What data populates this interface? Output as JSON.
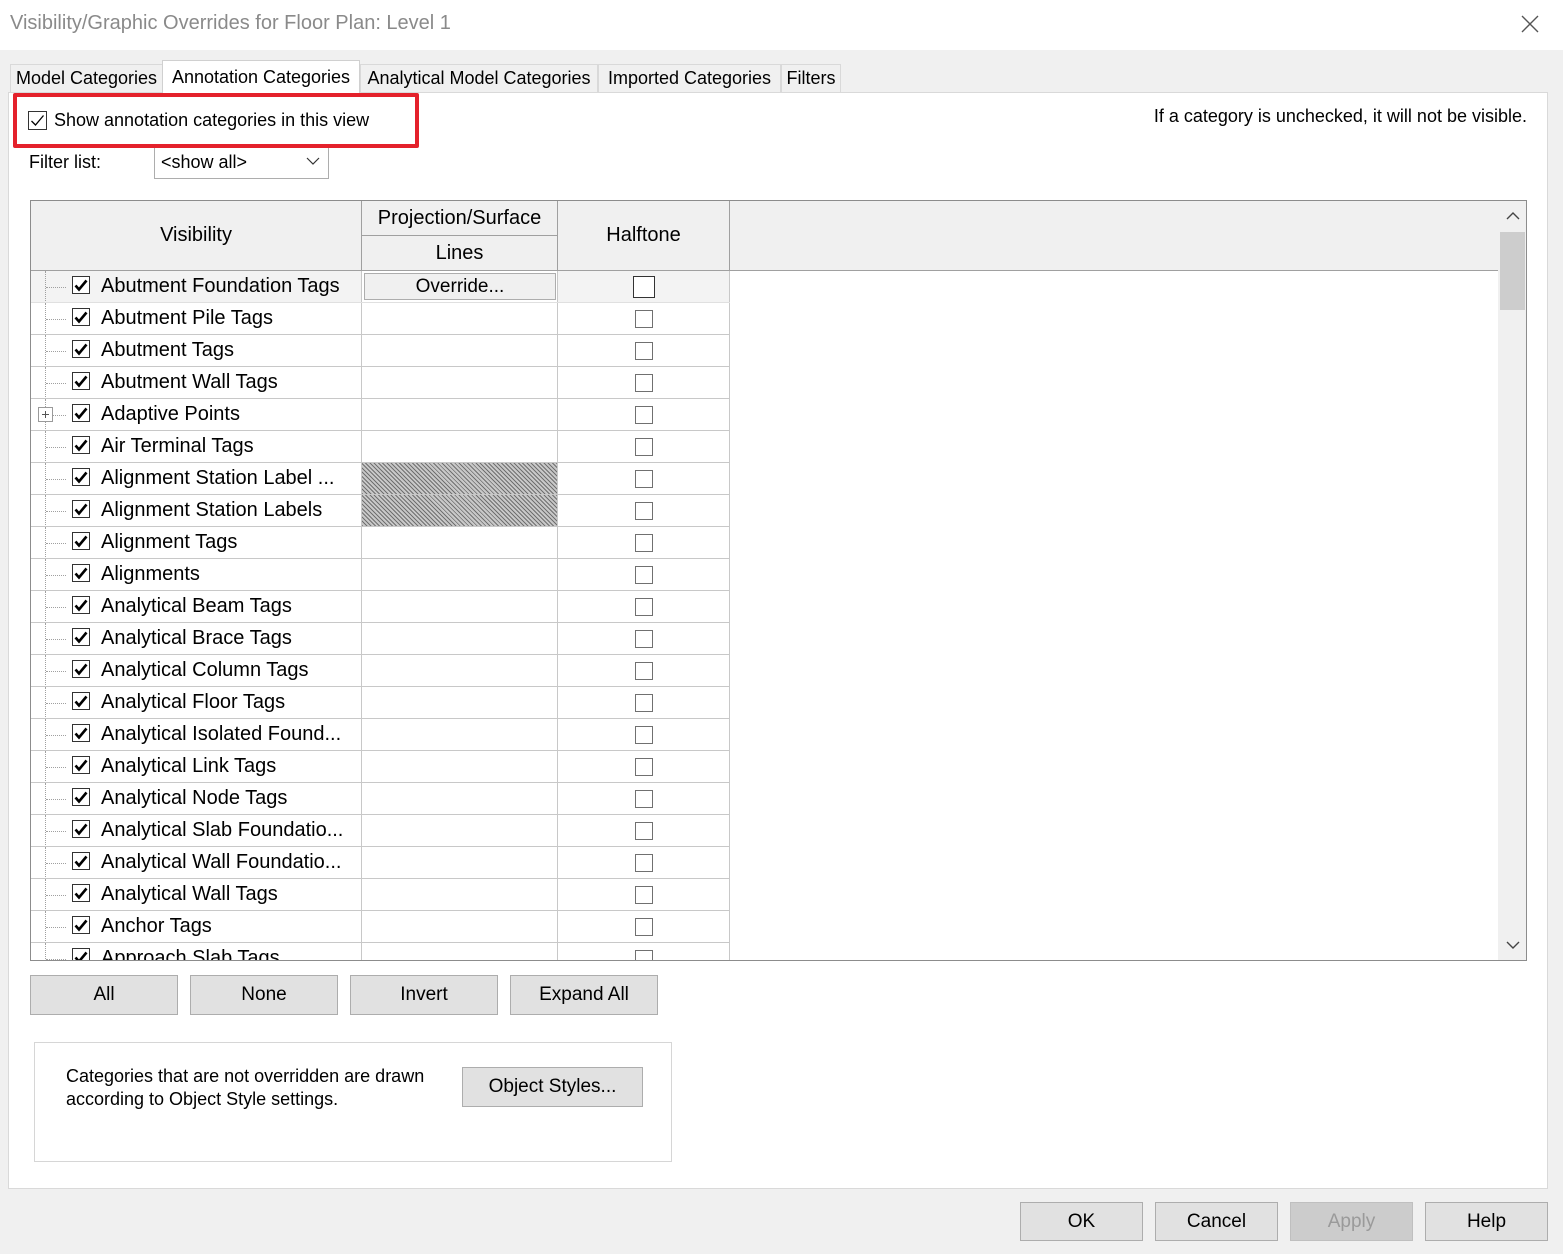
{
  "window": {
    "title": "Visibility/Graphic Overrides for Floor Plan: Level 1"
  },
  "tabs": [
    {
      "label": "Model Categories",
      "active": false
    },
    {
      "label": "Annotation Categories",
      "active": true
    },
    {
      "label": "Analytical Model Categories",
      "active": false
    },
    {
      "label": "Imported Categories",
      "active": false
    },
    {
      "label": "Filters",
      "active": false
    }
  ],
  "panel": {
    "show_categories_label": "Show annotation categories in this view",
    "show_categories_checked": true,
    "hint": "If a category is unchecked, it will not be visible.",
    "filter_label": "Filter list:",
    "filter_value": "<show all>"
  },
  "grid": {
    "headers": {
      "visibility": "Visibility",
      "projection_surface": "Projection/Surface",
      "lines": "Lines",
      "halftone": "Halftone"
    },
    "override_label": "Override...",
    "rows": [
      {
        "name": "Abutment Foundation Tags",
        "visible": true,
        "halftone": false,
        "selected": true
      },
      {
        "name": "Abutment Pile Tags",
        "visible": true,
        "halftone": false
      },
      {
        "name": "Abutment Tags",
        "visible": true,
        "halftone": false
      },
      {
        "name": "Abutment Wall Tags",
        "visible": true,
        "halftone": false
      },
      {
        "name": "Adaptive Points",
        "visible": true,
        "halftone": false,
        "expandable": true
      },
      {
        "name": "Air Terminal Tags",
        "visible": true,
        "halftone": false
      },
      {
        "name": "Alignment Station Label ...",
        "visible": true,
        "halftone": false,
        "lines_unavailable": true
      },
      {
        "name": "Alignment Station Labels",
        "visible": true,
        "halftone": false,
        "lines_unavailable": true
      },
      {
        "name": "Alignment Tags",
        "visible": true,
        "halftone": false
      },
      {
        "name": "Alignments",
        "visible": true,
        "halftone": false
      },
      {
        "name": "Analytical Beam Tags",
        "visible": true,
        "halftone": false
      },
      {
        "name": "Analytical Brace Tags",
        "visible": true,
        "halftone": false
      },
      {
        "name": "Analytical Column Tags",
        "visible": true,
        "halftone": false
      },
      {
        "name": "Analytical Floor Tags",
        "visible": true,
        "halftone": false
      },
      {
        "name": "Analytical Isolated Found...",
        "visible": true,
        "halftone": false
      },
      {
        "name": "Analytical Link Tags",
        "visible": true,
        "halftone": false
      },
      {
        "name": "Analytical Node Tags",
        "visible": true,
        "halftone": false
      },
      {
        "name": "Analytical Slab Foundatio...",
        "visible": true,
        "halftone": false
      },
      {
        "name": "Analytical Wall Foundatio...",
        "visible": true,
        "halftone": false
      },
      {
        "name": "Analytical Wall Tags",
        "visible": true,
        "halftone": false
      },
      {
        "name": "Anchor Tags",
        "visible": true,
        "halftone": false
      },
      {
        "name": "Approach Slab Tags",
        "visible": true,
        "halftone": false
      }
    ]
  },
  "grid_buttons": {
    "all": "All",
    "none": "None",
    "invert": "Invert",
    "expand_all": "Expand All"
  },
  "note": {
    "text": "Categories that are not overridden are drawn according to Object Style settings.",
    "object_styles": "Object Styles..."
  },
  "footer": {
    "ok": "OK",
    "cancel": "Cancel",
    "apply": "Apply",
    "help": "Help"
  },
  "colors": {
    "highlight": "#e4212b",
    "dialog_bg": "#f0f0f0",
    "disabled_text": "#9a9a9a"
  },
  "icons": {
    "close": "close-icon",
    "dropdown": "chevron-down-icon",
    "expand": "plus-box-icon",
    "scroll_up": "scroll-up-icon",
    "scroll_down": "scroll-down-icon"
  }
}
